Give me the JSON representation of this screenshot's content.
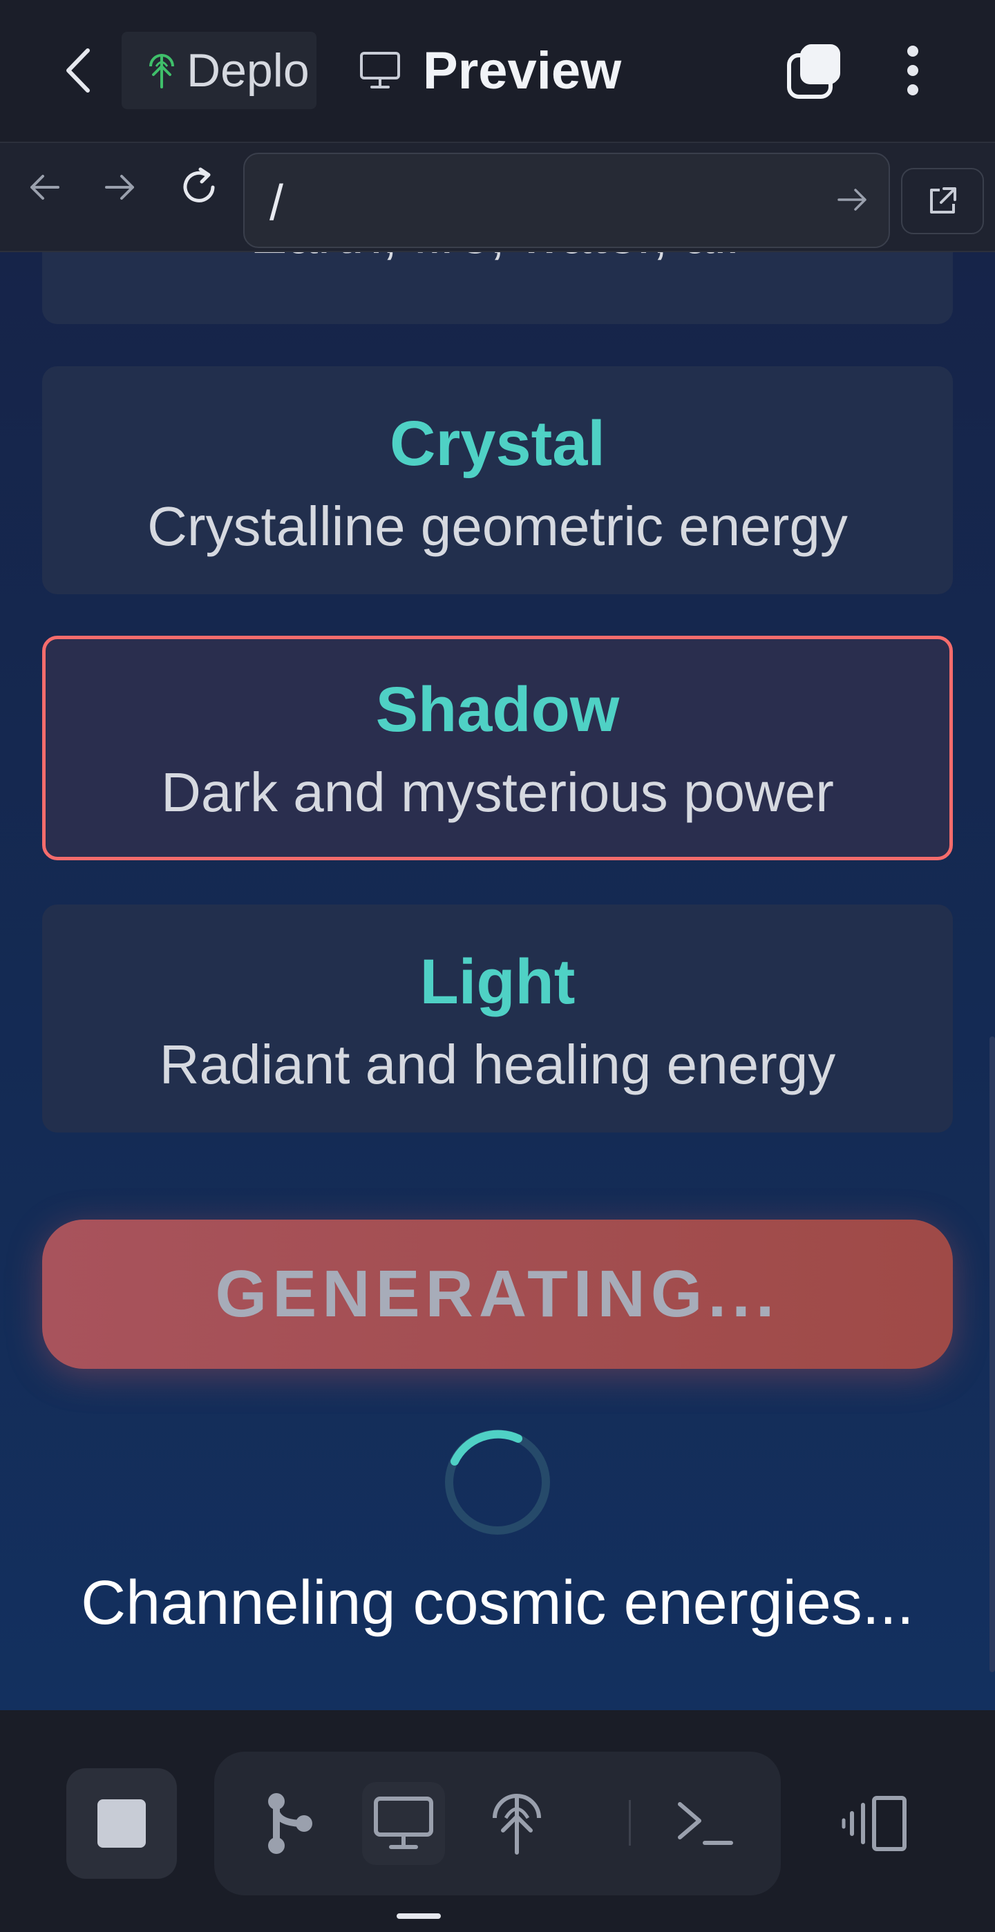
{
  "topbar": {
    "deploy_tab_label": "Deplo",
    "preview_tab_label": "Preview"
  },
  "urlbar": {
    "url": "/"
  },
  "themes": [
    {
      "name": "",
      "description": "Earth, fire, water, air"
    },
    {
      "name": "Crystal",
      "description": "Crystalline geometric energy"
    },
    {
      "name": "Shadow",
      "description": "Dark and mysterious power"
    },
    {
      "name": "Light",
      "description": "Radiant and healing energy"
    }
  ],
  "generate_button_label": "GENERATING...",
  "status_text": "Channeling cosmic energies...",
  "colors": {
    "accent_teal": "#4fd1c5",
    "selected_border": "#f56c6c",
    "button_gradient_start": "#a8535c",
    "button_gradient_end": "#9f4a47"
  },
  "icons": {
    "top": [
      "back-icon",
      "deploy-icon",
      "monitor-icon",
      "tabs-icon",
      "more-vert-icon"
    ],
    "nav": [
      "arrow-left-icon",
      "arrow-right-icon",
      "reload-icon",
      "go-icon",
      "external-link-icon"
    ],
    "bottom": [
      "stop-icon",
      "git-branch-icon",
      "monitor-icon",
      "deploy-icon",
      "terminal-icon",
      "devices-icon"
    ]
  }
}
